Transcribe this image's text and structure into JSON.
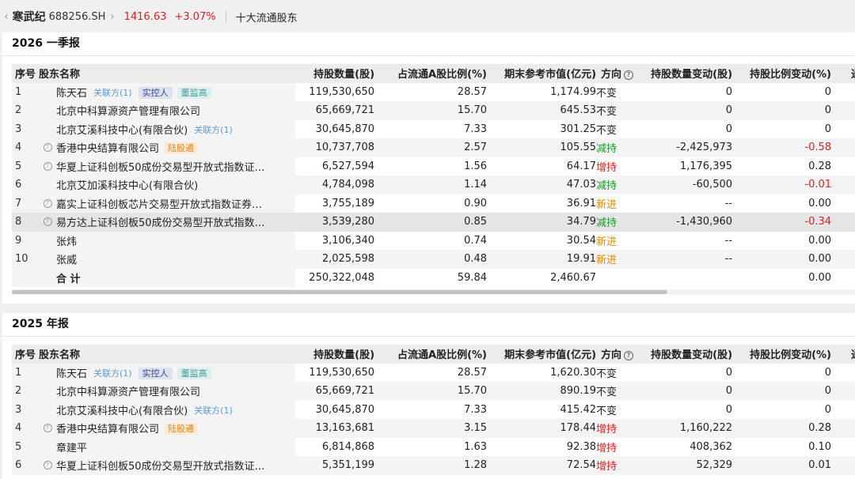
{
  "header": {
    "back_icon": "‹",
    "stock_name": "寒武纪",
    "stock_code": "688256.SH",
    "chevron_icon": "›",
    "price": "1416.63",
    "change": "+3.07%",
    "page_name": "十大流通股东"
  },
  "colors": {
    "up": "#e02020",
    "down": "#1a9a2a",
    "new": "#e58a00"
  },
  "columns": {
    "seq": "序号",
    "holder": "股东名称",
    "shares": "持股数量(股)",
    "ratio": "占流通A股比例(%)",
    "value": "期末参考市值(亿元)",
    "direction": "方向",
    "direction_help_icon": "?",
    "share_change": "持股数量变动(股)",
    "ratio_change": "持股比例变动(%)",
    "extra": "通过"
  },
  "q1": {
    "title": "2026 一季报",
    "rows": [
      {
        "seq": "1",
        "help": false,
        "name": "陈天石",
        "tags": [
          {
            "t": "关联方(1)",
            "k": "assoc"
          },
          {
            "t": "实控人",
            "k": "ctrl"
          },
          {
            "t": "董监高",
            "k": "exec"
          }
        ],
        "shares": "119,530,650",
        "ratio": "28.57",
        "value": "1,174.99",
        "dir": "不变",
        "dk": "unch",
        "schg": "0",
        "rchg": "0",
        "neg": false
      },
      {
        "seq": "2",
        "help": false,
        "name": "北京中科算源资产管理有限公司",
        "tags": [],
        "shares": "65,669,721",
        "ratio": "15.70",
        "value": "645.53",
        "dir": "不变",
        "dk": "unch",
        "schg": "0",
        "rchg": "0",
        "neg": false
      },
      {
        "seq": "3",
        "help": false,
        "name": "北京艾溪科技中心(有限合伙)",
        "tags": [
          {
            "t": "关联方(1)",
            "k": "assoc"
          }
        ],
        "shares": "30,645,870",
        "ratio": "7.33",
        "value": "301.25",
        "dir": "不变",
        "dk": "unch",
        "schg": "0",
        "rchg": "0",
        "neg": false
      },
      {
        "seq": "4",
        "help": true,
        "name": "香港中央结算有限公司",
        "tags": [
          {
            "t": "陆股通",
            "k": "hk"
          }
        ],
        "shares": "10,737,708",
        "ratio": "2.57",
        "value": "105.55",
        "dir": "减持",
        "dk": "dec",
        "schg": "-2,425,973",
        "rchg": "-0.58",
        "neg": true
      },
      {
        "seq": "5",
        "help": true,
        "name": "华夏上证科创板50成份交易型开放式指数证…",
        "tags": [],
        "shares": "6,527,594",
        "ratio": "1.56",
        "value": "64.17",
        "dir": "增持",
        "dk": "inc",
        "schg": "1,176,395",
        "rchg": "0.28",
        "neg": false
      },
      {
        "seq": "6",
        "help": false,
        "name": "北京艾加溪科技中心(有限合伙)",
        "tags": [],
        "shares": "4,784,098",
        "ratio": "1.14",
        "value": "47.03",
        "dir": "减持",
        "dk": "dec",
        "schg": "-60,500",
        "rchg": "-0.01",
        "neg": true
      },
      {
        "seq": "7",
        "help": true,
        "name": "嘉实上证科创板芯片交易型开放式指数证券…",
        "tags": [],
        "shares": "3,755,189",
        "ratio": "0.90",
        "value": "36.91",
        "dir": "新进",
        "dk": "new",
        "schg": "--",
        "rchg": "0.00",
        "neg": false
      },
      {
        "seq": "8",
        "help": true,
        "name": "易方达上证科创板50成份交易型开放式指数…",
        "tags": [],
        "shares": "3,539,280",
        "ratio": "0.85",
        "value": "34.79",
        "dir": "减持",
        "dk": "dec",
        "schg": "-1,430,960",
        "rchg": "-0.34",
        "neg": true
      },
      {
        "seq": "9",
        "help": false,
        "name": "张炜",
        "tags": [],
        "shares": "3,106,340",
        "ratio": "0.74",
        "value": "30.54",
        "dir": "新进",
        "dk": "new",
        "schg": "--",
        "rchg": "0.00",
        "neg": false
      },
      {
        "seq": "10",
        "help": false,
        "name": "张威",
        "tags": [],
        "shares": "2,025,598",
        "ratio": "0.48",
        "value": "19.91",
        "dir": "新进",
        "dk": "new",
        "schg": "--",
        "rchg": "0.00",
        "neg": false
      }
    ],
    "total": {
      "label": "合 计",
      "shares": "250,322,048",
      "ratio": "59.84",
      "value": "2,460.67",
      "rchg": "0.00"
    }
  },
  "y2025": {
    "title": "2025 年报",
    "rows": [
      {
        "seq": "1",
        "help": false,
        "name": "陈天石",
        "tags": [
          {
            "t": "关联方(1)",
            "k": "assoc"
          },
          {
            "t": "实控人",
            "k": "ctrl"
          },
          {
            "t": "董监高",
            "k": "exec"
          }
        ],
        "shares": "119,530,650",
        "ratio": "28.57",
        "value": "1,620.30",
        "dir": "不变",
        "dk": "unch",
        "schg": "0",
        "rchg": "0",
        "neg": false
      },
      {
        "seq": "2",
        "help": false,
        "name": "北京中科算源资产管理有限公司",
        "tags": [],
        "shares": "65,669,721",
        "ratio": "15.70",
        "value": "890.19",
        "dir": "不变",
        "dk": "unch",
        "schg": "0",
        "rchg": "0",
        "neg": false
      },
      {
        "seq": "3",
        "help": false,
        "name": "北京艾溪科技中心(有限合伙)",
        "tags": [
          {
            "t": "关联方(1)",
            "k": "assoc"
          }
        ],
        "shares": "30,645,870",
        "ratio": "7.33",
        "value": "415.42",
        "dir": "不变",
        "dk": "unch",
        "schg": "0",
        "rchg": "0",
        "neg": false
      },
      {
        "seq": "4",
        "help": true,
        "name": "香港中央结算有限公司",
        "tags": [
          {
            "t": "陆股通",
            "k": "hk"
          }
        ],
        "shares": "13,163,681",
        "ratio": "3.15",
        "value": "178.44",
        "dir": "增持",
        "dk": "inc",
        "schg": "1,160,222",
        "rchg": "0.28",
        "neg": false
      },
      {
        "seq": "5",
        "help": false,
        "name": "章建平",
        "tags": [],
        "shares": "6,814,868",
        "ratio": "1.63",
        "value": "92.38",
        "dir": "增持",
        "dk": "inc",
        "schg": "408,362",
        "rchg": "0.10",
        "neg": false
      },
      {
        "seq": "6",
        "help": true,
        "name": "华夏上证科创板50成份交易型开放式指数证…",
        "tags": [],
        "shares": "5,351,199",
        "ratio": "1.28",
        "value": "72.54",
        "dir": "增持",
        "dk": "inc",
        "schg": "52,329",
        "rchg": "0.01",
        "neg": false
      }
    ]
  }
}
